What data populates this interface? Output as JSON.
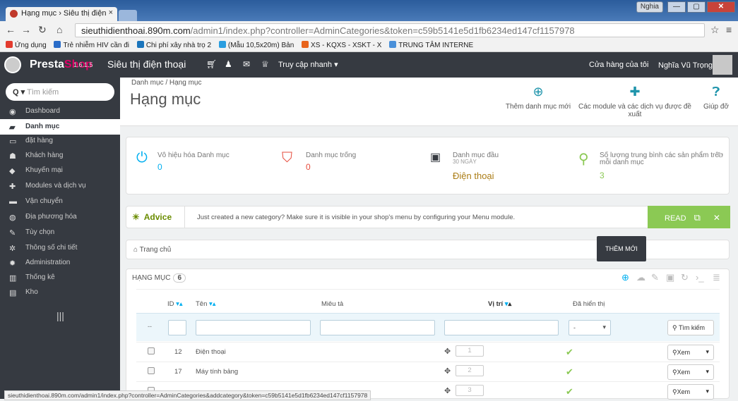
{
  "browser": {
    "tab_title": "Hạng mục › Siêu thị điện",
    "tab_close": "×",
    "user_badge": "Nghia",
    "url_host": "sieuthidienthoai.890m.com",
    "url_path": "/admin1/index.php?controller=AdminCategories&token=c59b5141e5d1fb6234ed147cf1157978",
    "bookmarks": [
      "Ứng dụng",
      "Trẻ nhiễm HIV cần đi",
      "Chi phí xây nhà trọ 2",
      "(Mẫu 10,5x20m) Bản",
      "XS - KQXS - XSKT - X",
      "TRUNG TÂM INTERNE"
    ],
    "bookmark_colors": [
      "#e33b2e",
      "#2a6cc8",
      "#1b75bc",
      "#2a9ee0",
      "#e8641b",
      "#4a90d9"
    ],
    "status_url": "sieuthidienthoai.890m.com/admin1/index.php?controller=AdminCategories&addcategory&token=c59b5141e5d1fb6234ed147cf1157978"
  },
  "header": {
    "brand1": "Presta",
    "brand2": "Shop",
    "version": "1.6.1.5",
    "shop_name": "Siêu thị điện thoại",
    "quick_access": "Truy cập nhanh ▾",
    "my_shop": "Cửa hàng của tôi",
    "user": "Nghĩa Vũ Trọng ▾"
  },
  "sidebar": {
    "search_label": "Q ▾",
    "search_placeholder": "Tìm kiếm",
    "items": [
      {
        "label": "Dashboard",
        "icon": "◉"
      },
      {
        "label": "Danh mục",
        "icon": "▰"
      },
      {
        "label": "đặt hàng",
        "icon": "▭"
      },
      {
        "label": "Khách hàng",
        "icon": "☗"
      },
      {
        "label": "Khuyến mại",
        "icon": "◆"
      },
      {
        "label": "Modules và dịch vụ",
        "icon": "✚"
      },
      {
        "label": "Vận chuyển",
        "icon": "▬"
      },
      {
        "label": "Địa phương hóa",
        "icon": "◍"
      },
      {
        "label": "Tùy chọn",
        "icon": "✎"
      },
      {
        "label": "Thông số chi tiết",
        "icon": "✲"
      },
      {
        "label": "Administration",
        "icon": "✹"
      },
      {
        "label": "Thống kê",
        "icon": "▥"
      },
      {
        "label": "Kho",
        "icon": "▤"
      }
    ],
    "collapse": "|||"
  },
  "toolbar": {
    "breadcrumb": "Danh mục  /  Hạng mục",
    "title": "Hạng mục",
    "add_label": "Thêm danh mục mới",
    "modules_label": "Các module và các dịch vụ được đề xuất",
    "help_label": "Giúp đỡ"
  },
  "kpis": [
    {
      "title": "Vô hiệu hóa Danh mục",
      "value": "0",
      "color": "#00aff0"
    },
    {
      "title": "Danh mục trống",
      "value": "0",
      "color": "#e64b3c"
    },
    {
      "title": "Danh mục đầu",
      "subtitle": "30 NGÀY",
      "value": "Điện thoại",
      "color": "#363a41"
    },
    {
      "title": "Số lượng trung bình các sản phẩm trên",
      "title2": "mỗi danh mục",
      "value": "3",
      "color": "#8bc954"
    }
  ],
  "advice": {
    "label": "Advice",
    "text": "Just created a new category? Make sure it is visible in your shop's menu by configuring your Menu module.",
    "read": "READ",
    "close": "✕"
  },
  "breadcrumb_home": "Trang chủ",
  "tooltip": "THÊM MỚI",
  "table": {
    "heading": "HẠNG MỤC",
    "count": "6",
    "col_id": "ID",
    "col_name": "Tên",
    "col_desc": "Miêu tả",
    "col_pos": "Vị trí",
    "col_shown": "Đã hiển thị",
    "sort_desc": "▾",
    "sort_asc": "▴",
    "filter_dash": "--",
    "filter_select": "-",
    "search_btn": "Tìm kiếm",
    "view_btn": "Xem",
    "rows": [
      {
        "id": "12",
        "name": "Điện thoại",
        "pos": "1"
      },
      {
        "id": "17",
        "name": "Máy tính bảng",
        "pos": "2"
      },
      {
        "id": "",
        "name": "",
        "pos": "3"
      }
    ]
  }
}
